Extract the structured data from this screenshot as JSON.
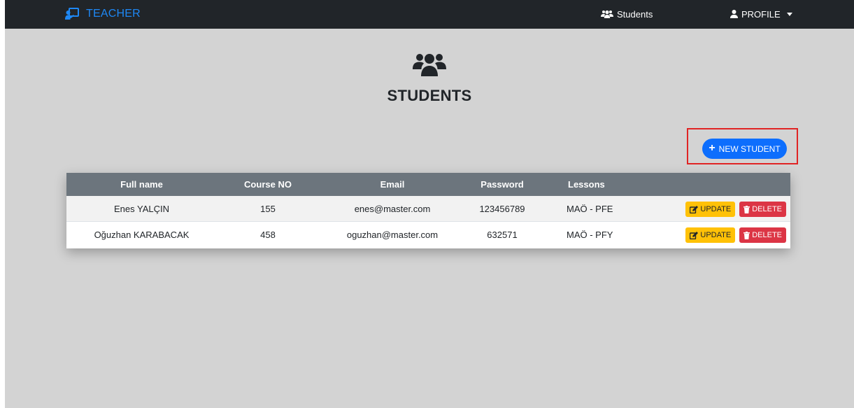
{
  "navbar": {
    "brand_label": "TEACHER",
    "brand_icon": "chalkboard-teacher-icon",
    "students_link": "Students",
    "students_icon": "users-icon",
    "profile_link": "PROFILE",
    "profile_icon": "user-icon"
  },
  "header": {
    "icon": "users-icon",
    "title": "STUDENTS"
  },
  "new_student_button": "NEW STUDENT",
  "table": {
    "columns": [
      "Full name",
      "Course NO",
      "Email",
      "Password",
      "Lessons"
    ],
    "rows": [
      {
        "full_name": "Enes YALÇIN",
        "course_no": "155",
        "email": "enes@master.com",
        "password": "123456789",
        "lessons": "MAÖ - PFE",
        "update_label": "UPDATE",
        "delete_label": "DELETE"
      },
      {
        "full_name": "Oğuzhan KARABACAK",
        "course_no": "458",
        "email": "oguzhan@master.com",
        "password": "632571",
        "lessons": "MAÖ - PFY",
        "update_label": "UPDATE",
        "delete_label": "DELETE"
      }
    ]
  },
  "colors": {
    "navbar_bg": "#212529",
    "brand": "#1e88f5",
    "page_bg": "#d3d3d3",
    "table_header_bg": "#6c757d",
    "primary": "#0d6efd",
    "warning": "#ffc107",
    "danger": "#dc3545",
    "highlight": "#e02424"
  }
}
